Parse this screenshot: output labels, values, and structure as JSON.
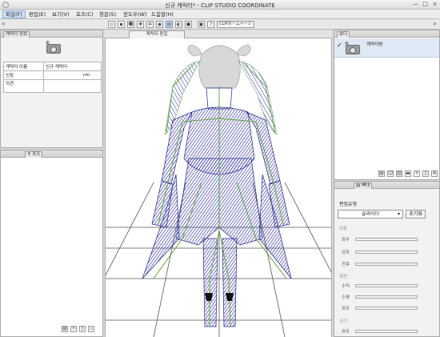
{
  "window": {
    "title": "신규 캐릭터* - CLIP STUDIO COORDINATE",
    "minimize": "—",
    "maximize": "□",
    "close": "×"
  },
  "menu": [
    "파일(F)",
    "편집(E)",
    "보기(V)",
    "포즈(C)",
    "창문(S)",
    "윈도우(W)",
    "도움말(H)"
  ],
  "toolbar": {
    "clip_label": "CLIPホームページ",
    "left_arrow": "«",
    "right_arrow": "»"
  },
  "left_panel": {
    "tab": "캐릭터 정보",
    "rows": [
      {
        "label": "캐릭터 이름",
        "value": "신규 캐릭터"
      },
      {
        "label": "신장",
        "value": "cm"
      },
      {
        "label": "의견",
        "value": ""
      }
    ],
    "tab2": "포즈"
  },
  "canvas": {
    "tab": "캐릭터 편집"
  },
  "right_panel": {
    "tab": "보디",
    "item_label": "캐릭터명",
    "tab2": "뼈대",
    "edit_mode_label": "편집유형",
    "mode_select": "슬라이더",
    "reset_button": "초기화",
    "sections": [
      {
        "title": "이동",
        "rows": [
          "좌우",
          "상하",
          "전후"
        ]
      },
      {
        "title": "회전",
        "rows": [
          "수직",
          "수평",
          "좌우"
        ]
      },
      {
        "title": "크기",
        "rows": [
          "좌우"
        ]
      }
    ]
  },
  "colors": {
    "accent": "#3a3aa8",
    "bone": "#8fcc3f",
    "mesh": "#3333aa"
  }
}
